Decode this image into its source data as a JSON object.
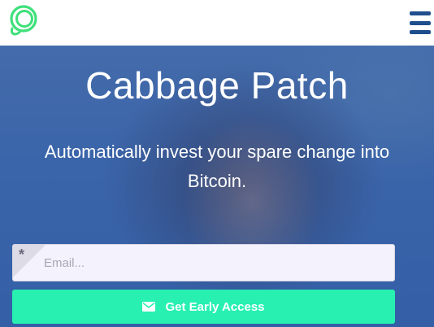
{
  "header": {
    "logo_icon": "cabbage-logo-icon",
    "menu_icon": "hamburger-menu-icon",
    "colors": {
      "logo": "#3ee07a",
      "menu": "#1f4e8c"
    }
  },
  "hero": {
    "title": "Cabbage Patch",
    "subtitle": "Automatically invest your spare change into Bitcoin."
  },
  "form": {
    "email_placeholder": "Email...",
    "email_value": "",
    "required_marker": "*",
    "submit_label": "Get Early Access",
    "submit_icon": "envelope-icon",
    "colors": {
      "button": "#27f0b0",
      "field_bg": "#f4f2fc"
    }
  }
}
